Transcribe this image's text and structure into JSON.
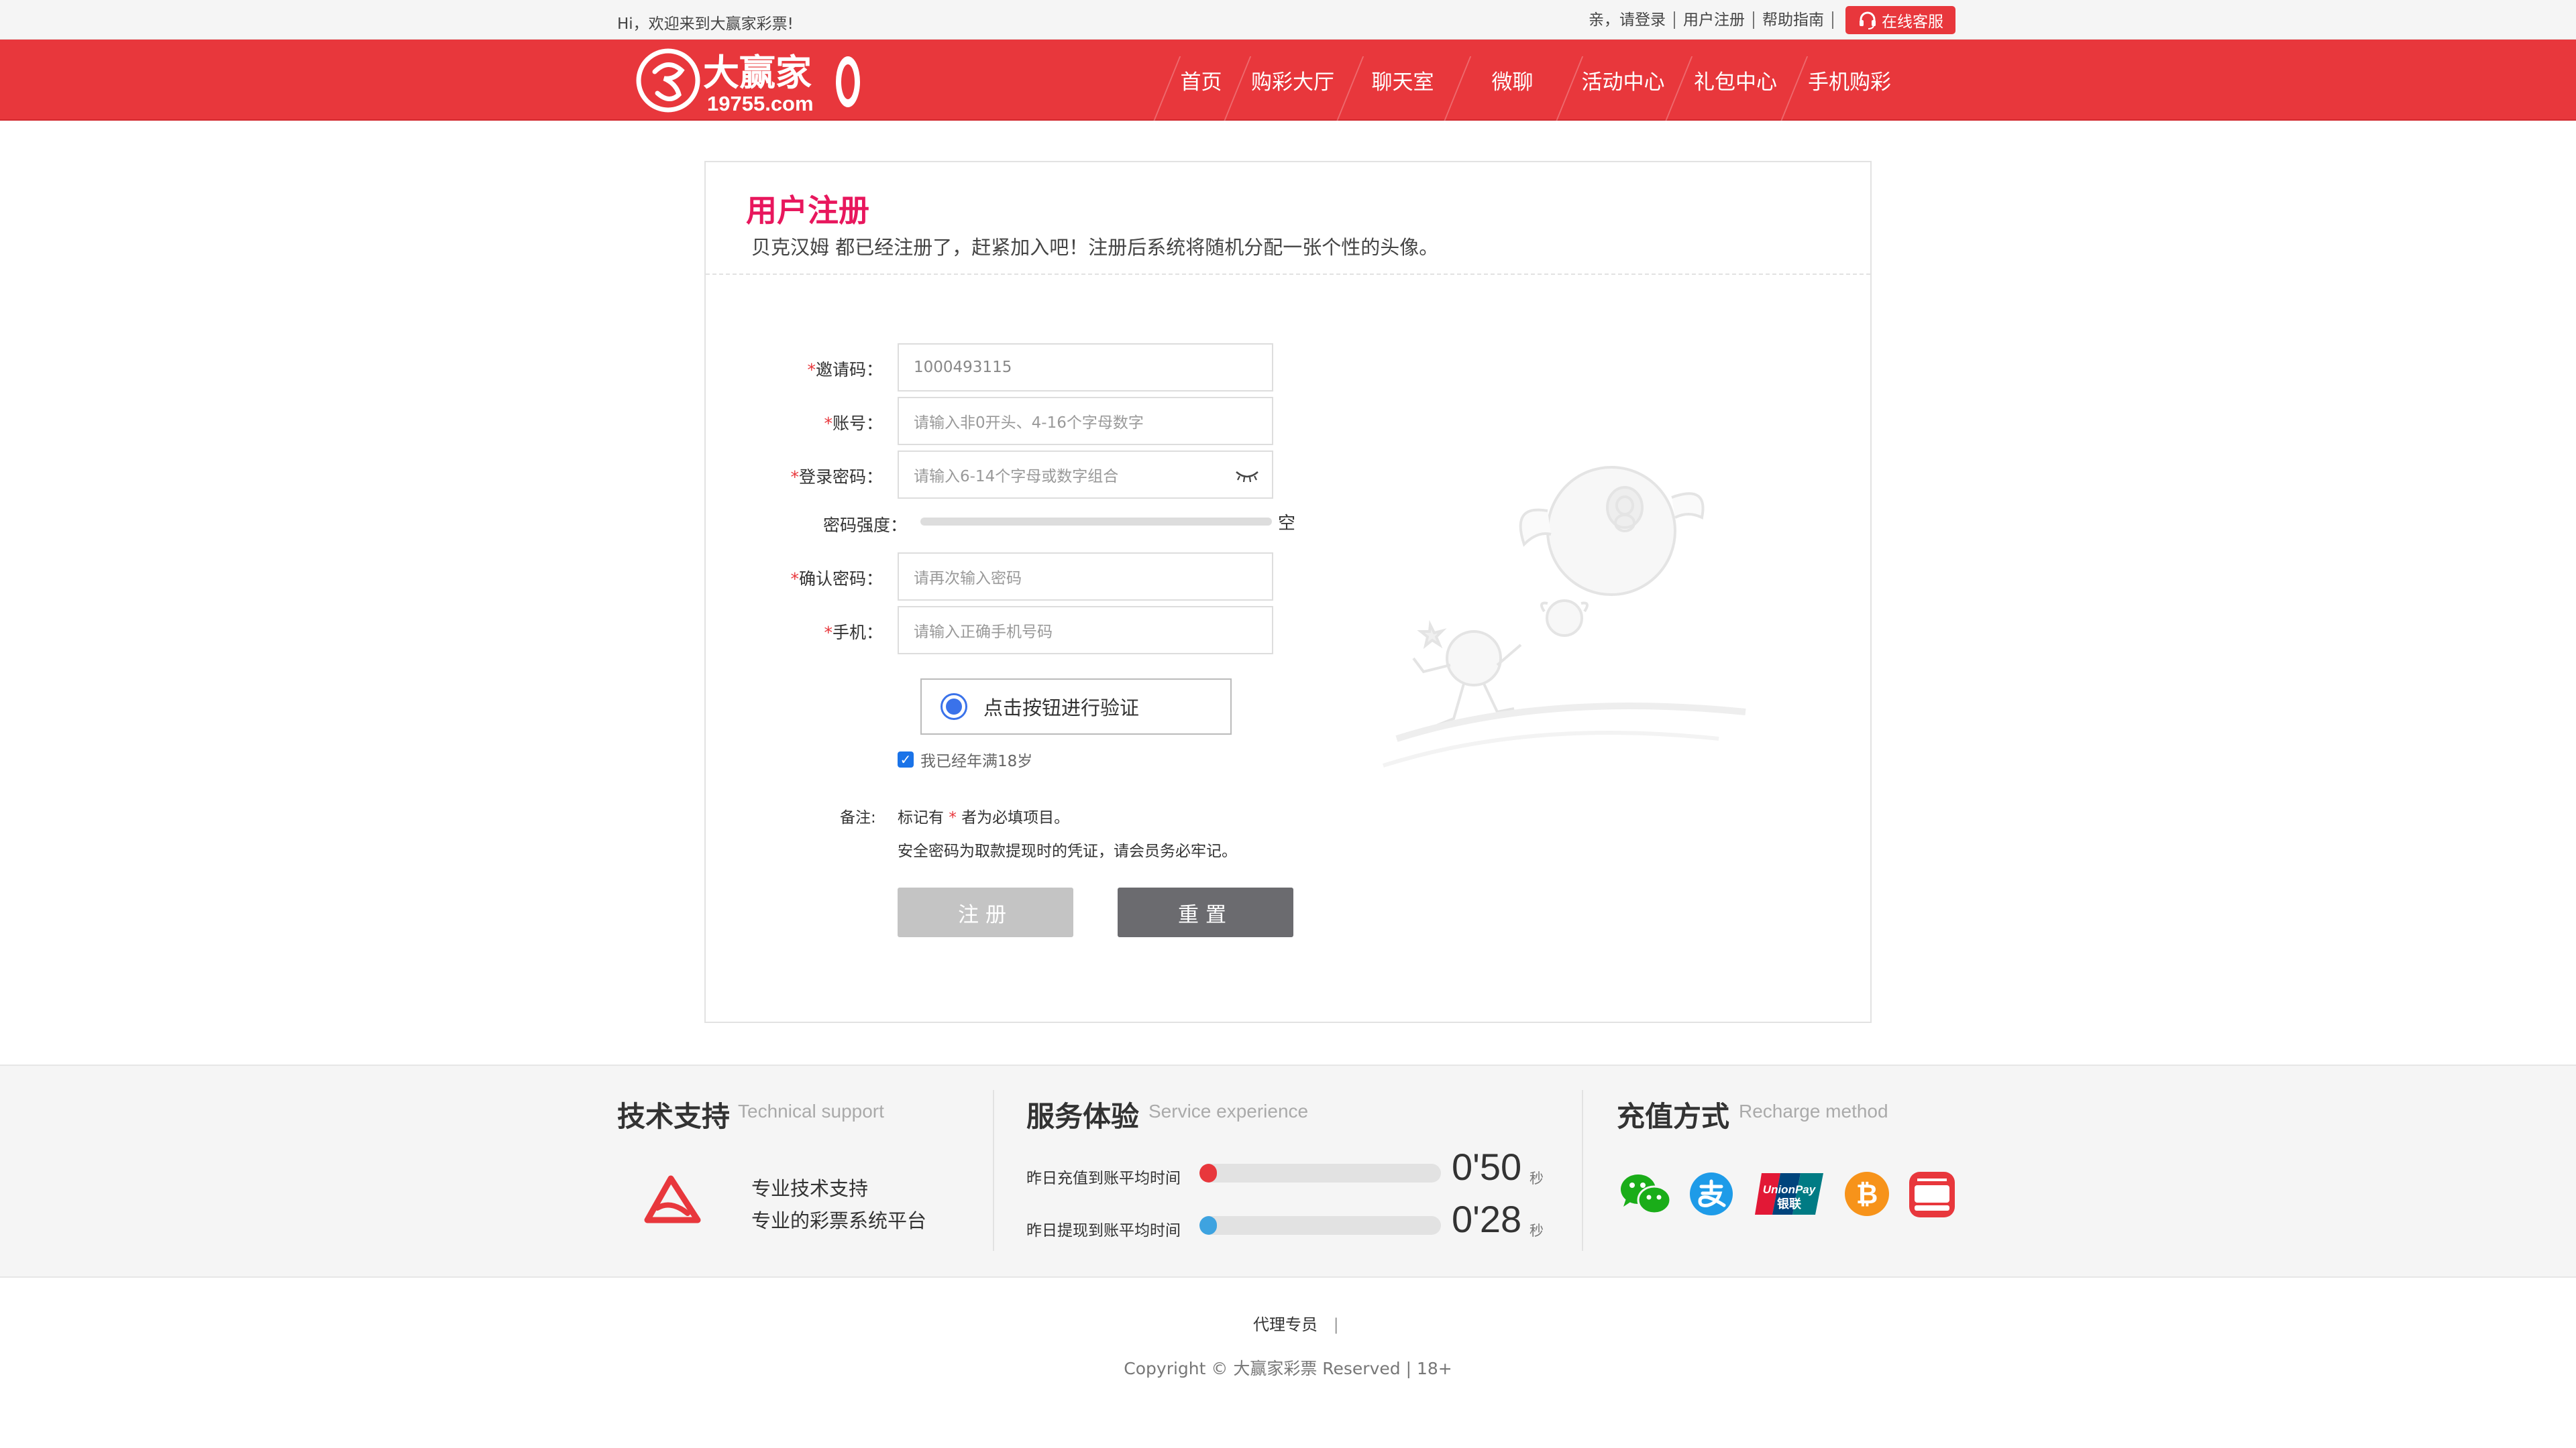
{
  "topbar": {
    "welcome": "Hi，欢迎来到大赢家彩票!",
    "login": "亲，请登录",
    "register": "用户注册",
    "help": "帮助指南",
    "service": "在线客服"
  },
  "header": {
    "logo_name": "大赢家",
    "logo_domain": "19755.com",
    "nav": [
      "首页",
      "购彩大厅",
      "聊天室",
      "微聊",
      "活动中心",
      "礼包中心",
      "手机购彩"
    ]
  },
  "form": {
    "title": "用户注册",
    "subtitle": "贝克汉姆 都已经注册了，赶紧加入吧！注册后系统将随机分配一张个性的头像。",
    "fields": [
      {
        "label": "邀请码：",
        "required": "*",
        "value": "1000493115"
      },
      {
        "label": "账号：",
        "required": "*",
        "placeholder": "请输入非0开头、4-16个字母数字"
      },
      {
        "label": "登录密码：",
        "required": "*",
        "placeholder": "请输入6-14个字母或数字组合"
      },
      {
        "label": "确认密码：",
        "required": "*",
        "placeholder": "请再次输入密码"
      },
      {
        "label": "手机：",
        "required": "*",
        "placeholder": "请输入正确手机号码"
      }
    ],
    "strength_label": "密码强度：",
    "strength_value": "空",
    "verify": "点击按钮进行验证",
    "age_check": "我已经年满18岁",
    "note_label": "备注:",
    "note1_a": "标记有",
    "note1_star": "*",
    "note1_b": "者为必填项目。",
    "note2": "安全密码为取款提现时的凭证，请会员务必牢记。",
    "submit": "注册",
    "reset": "重置"
  },
  "footer": {
    "tech_title": "技术支持",
    "tech_en": "Technical support",
    "tech_line1": "专业技术支持",
    "tech_line2": "专业的彩票系统平台",
    "svc_title": "服务体验",
    "svc_en": "Service experience",
    "svc_rows": [
      {
        "label": "昨日充值到账平均时间",
        "value": "0'50",
        "unit": "秒",
        "color": "#e8373c"
      },
      {
        "label": "昨日提现到账平均时间",
        "value": "0'28",
        "unit": "秒",
        "color": "#3ea3e0"
      }
    ],
    "pay_title": "充值方式",
    "pay_en": "Recharge method",
    "pay_methods": [
      "wechat-pay-icon",
      "alipay-icon",
      "unionpay-icon",
      "bitcoin-icon",
      "cloud-pay-icon"
    ],
    "unionpay_text": "UnionPay",
    "unionpay_cn": "银联",
    "agent": "代理专员",
    "agent_sep": "|",
    "copyright": "Copyright © 大赢家彩票 Reserved | 18+"
  }
}
